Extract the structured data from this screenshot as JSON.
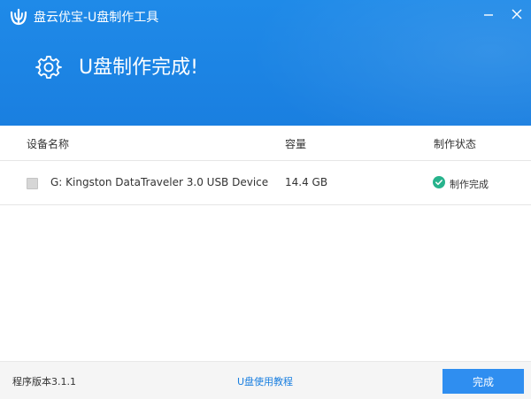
{
  "window": {
    "title": "盘云优宝-U盘制作工具"
  },
  "banner": {
    "title": "U盘制作完成!"
  },
  "table": {
    "headers": {
      "name": "设备名称",
      "capacity": "容量",
      "status": "制作状态"
    },
    "rows": [
      {
        "device": "G: Kingston DataTraveler 3.0 USB Device",
        "capacity": "14.4 GB",
        "status": "制作完成"
      }
    ]
  },
  "footer": {
    "version": "程序版本3.1.1",
    "tutorial_link": "U盘使用教程",
    "done_button": "完成"
  },
  "colors": {
    "header_blue": "#1a7fe0",
    "button_blue": "#2f8ef0",
    "success_green": "#27b38c"
  }
}
